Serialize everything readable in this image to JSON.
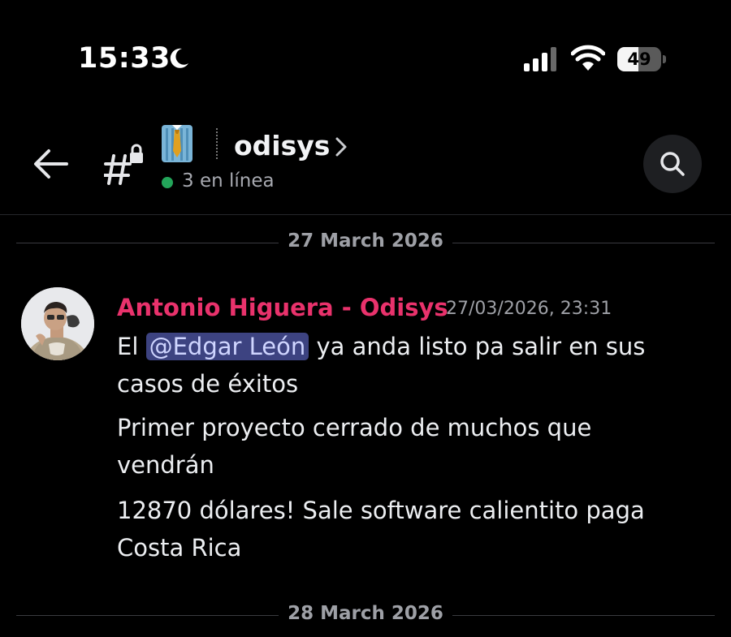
{
  "status_bar": {
    "time": "15:33",
    "battery_level": "49",
    "battery_fraction": 0.49
  },
  "header": {
    "channel_emoji": "necktie",
    "channel_name": "odisys",
    "online_status": "3 en línea"
  },
  "dividers": [
    "27 March 2026",
    "28 March 2026"
  ],
  "message": {
    "author": "Antonio Higuera - Odisys",
    "timestamp": "27/03/2026, 23:31",
    "line1_pre": "El ",
    "mention": "@Edgar León",
    "line1_post": " ya anda listo pa salir en sus casos de éxitos",
    "line2": "Primer proyecto cerrado de muchos que vendrán",
    "line3": "12870 dólares! Sale software calientito paga Costa Rica"
  },
  "colors": {
    "author": "#e9326c",
    "online": "#23a55a",
    "mention_bg": "#3d4381"
  }
}
